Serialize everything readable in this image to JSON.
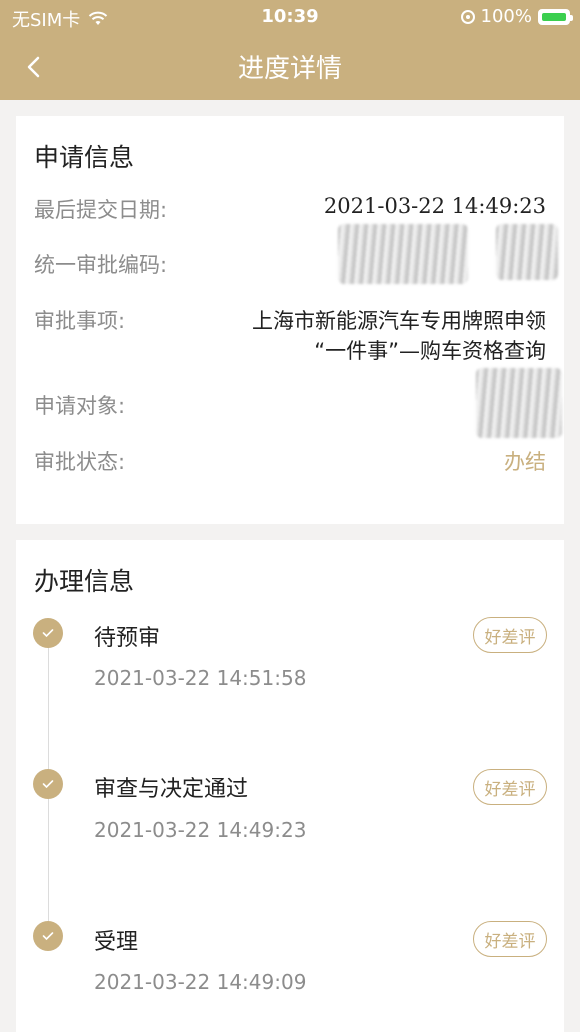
{
  "status_bar": {
    "carrier": "无SIM卡",
    "time": "10:39",
    "battery": "100%"
  },
  "nav": {
    "title": "进度详情"
  },
  "application_info": {
    "title": "申请信息",
    "rows": [
      {
        "label": "最后提交日期:",
        "value": "2021-03-22 14:49:23"
      },
      {
        "label": "统一审批编码:",
        "value": ""
      },
      {
        "label": "审批事项:",
        "value_line1": "上海市新能源汽车专用牌照申领",
        "value_line2": "“一件事”—购车资格查询"
      },
      {
        "label": "申请对象:",
        "value": ""
      },
      {
        "label": "审批状态:",
        "value": "办结"
      }
    ]
  },
  "processing_info": {
    "title": "办理信息",
    "steps": [
      {
        "title": "待预审",
        "time": "2021-03-22 14:51:58",
        "rate_label": "好差评"
      },
      {
        "title": "审查与决定通过",
        "time": "2021-03-22 14:49:23",
        "rate_label": "好差评"
      },
      {
        "title": "受理",
        "time": "2021-03-22 14:49:09",
        "rate_label": "好差评"
      }
    ]
  },
  "colors": {
    "accent": "#c9b07f",
    "background": "#f3f2f1"
  }
}
